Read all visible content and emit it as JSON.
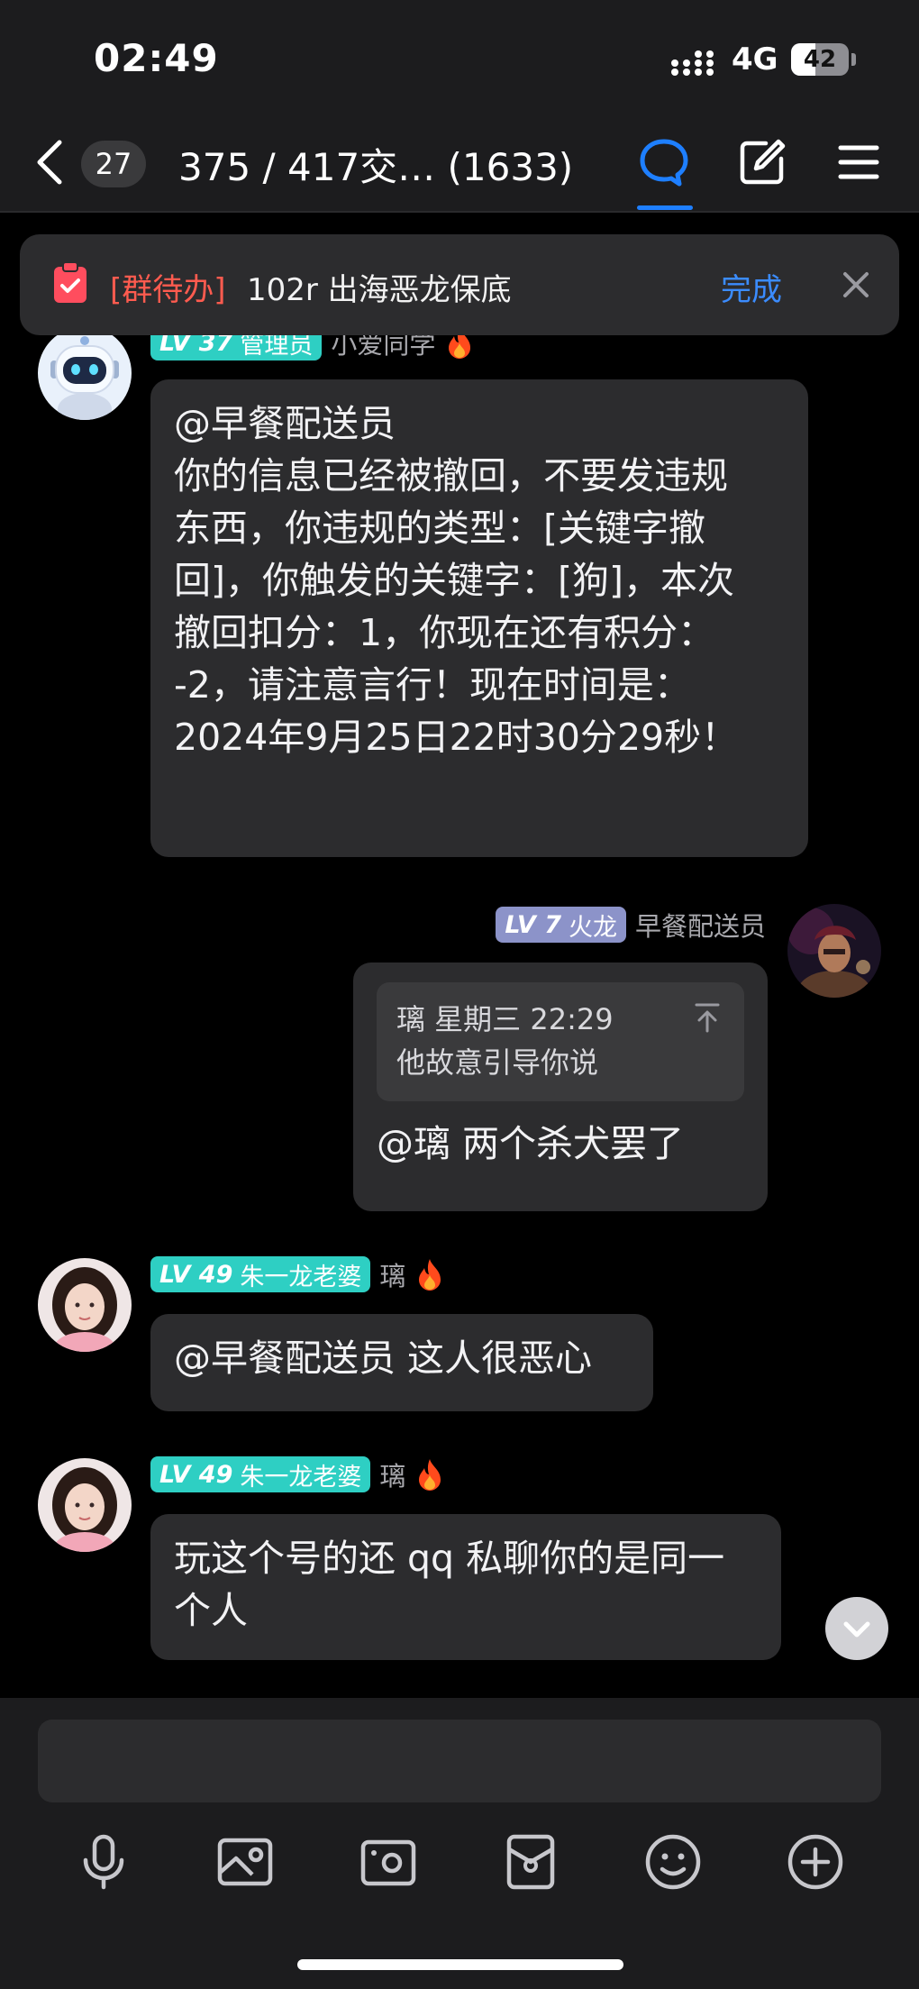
{
  "status_bar": {
    "time": "02:49",
    "network": "4G",
    "battery": "42",
    "battery_level": 0.42
  },
  "header": {
    "unread_count": "27",
    "title": "375 / 417交… (1633)",
    "icons": [
      "chevron-left-icon",
      "chat-bubble-icon",
      "edit-icon",
      "menu-icon"
    ],
    "active_color": "#1e7fff"
  },
  "todo_banner": {
    "tag": "[群待办]",
    "text": "102r 出海恶龙保底",
    "done_label": "完成",
    "tag_color": "#ff5b4f",
    "done_color": "#3b8cff"
  },
  "messages": [
    {
      "level": "LV 37",
      "title": "管理员",
      "nick": "小爱同学",
      "badge_color": "#2ecfc3",
      "lines": [
        "@早餐配送员",
        "你的信息已经被撤回，不要发违规",
        "东西，你违规的类型：[关键字撤",
        "回]，你触发的关键字：[狗]，本次",
        "撤回扣分：1，你现在还有积分：",
        "-2，请注意言行！现在时间是：",
        "2024年9月25日22时30分29秒！"
      ]
    },
    {
      "level": "LV 7",
      "title": "火龙",
      "nick": "早餐配送员",
      "badge_color": "#8c93c9",
      "quote": {
        "header": "璃  星期三 22:29",
        "text": "他故意引导你说"
      },
      "text": "@璃 两个杀犬罢了"
    },
    {
      "level": "LV 49",
      "title": "朱一龙老婆",
      "nick": "璃",
      "badge_color": "#2ecfc3",
      "text": "@早餐配送员 这人很恶心"
    },
    {
      "level": "LV 49",
      "title": "朱一龙老婆",
      "nick": "璃",
      "badge_color": "#2ecfc3",
      "lines": [
        "玩这个号的还 qq 私聊你的是同一",
        "个人"
      ]
    }
  ],
  "toolbar": {
    "icons": [
      "microphone-icon",
      "image-icon",
      "camera-icon",
      "red-packet-icon",
      "emoji-icon",
      "plus-icon"
    ]
  }
}
